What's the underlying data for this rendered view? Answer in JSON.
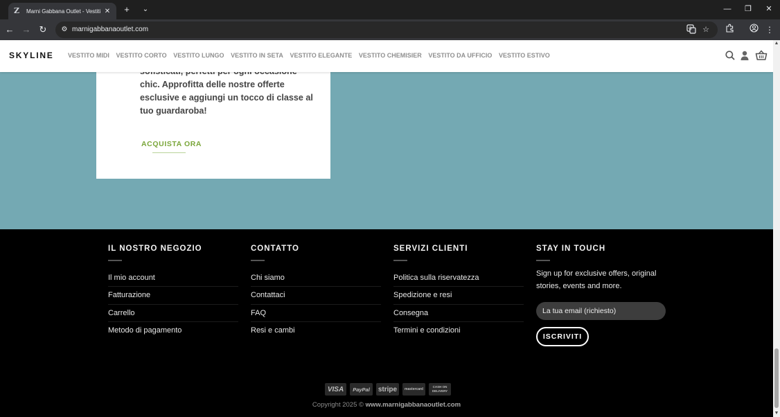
{
  "browser": {
    "tab_title": "Marni Gabbana Outlet - Vestiti ...",
    "tab_favicon": "Z",
    "new_tab_icon": "plus-icon",
    "url": "marnigabbanaoutlet.com"
  },
  "header": {
    "logo": "SKYLINE",
    "menu": [
      "VESTITO MIDI",
      "VESTITO CORTO",
      "VESTITO LUNGO",
      "VESTITO IN SETA",
      "VESTITO ELEGANTE",
      "VESTITO CHEMISIER",
      "VESTITO DA UFFICIO",
      "VESTITO ESTIVO"
    ]
  },
  "promo": {
    "lines": [
      "sofisticati, perfetti per ogni occasione",
      "chic. Approfitta delle nostre offerte",
      "esclusive e aggiungi un tocco di classe al",
      "tuo guardaroba!"
    ],
    "cta": "ACQUISTA ORA"
  },
  "footer": {
    "columns": [
      {
        "heading": "IL NOSTRO NEGOZIO",
        "links": [
          "Il mio account",
          "Fatturazione",
          "Carrello",
          "Metodo di pagamento"
        ]
      },
      {
        "heading": "CONTATTO",
        "links": [
          "Chi siamo",
          "Contattaci",
          "FAQ",
          "Resi e cambi"
        ]
      },
      {
        "heading": "SERVIZI CLIENTI",
        "links": [
          "Politica sulla riservatezza",
          "Spedizione e resi",
          "Consegna",
          "Termini e condizioni"
        ]
      }
    ],
    "newsletter": {
      "heading": "STAY IN TOUCH",
      "text": "Sign up for exclusive offers, original stories, events and more.",
      "email_placeholder": "La tua email (richiesto)",
      "button": "ISCRIVITI"
    },
    "payments": [
      "VISA",
      "PayPal",
      "stripe",
      "mastercard",
      "CASH ON DELIVERY"
    ],
    "copyright_prefix": "Copyright 2025 ©",
    "copyright_site": "www.marnigabbanaoutlet.com"
  },
  "colors": {
    "background_teal": "#74a9b3",
    "cta_green": "#7aa63a",
    "footer_bg": "#000000"
  }
}
